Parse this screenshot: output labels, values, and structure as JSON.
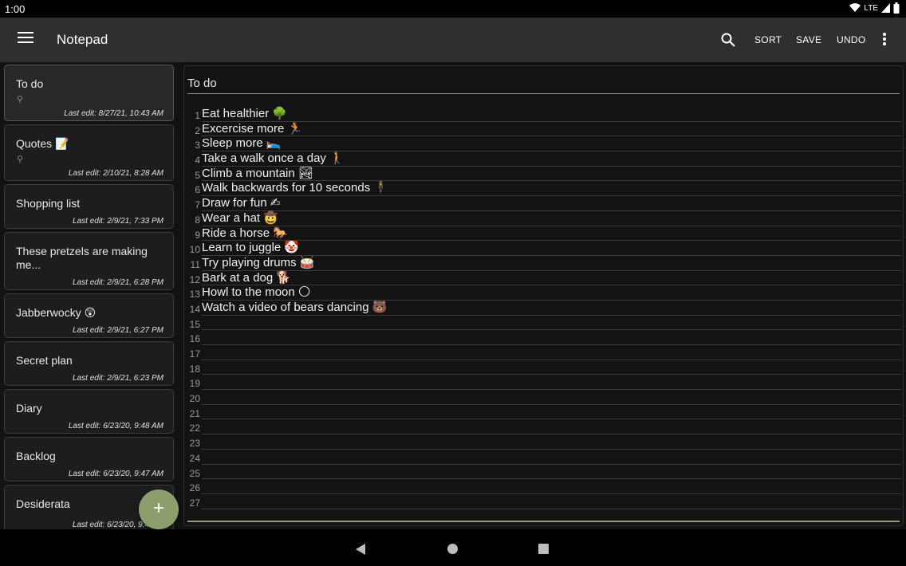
{
  "status_bar": {
    "time": "1:00",
    "network": "LTE"
  },
  "app_bar": {
    "title": "Notepad",
    "actions": {
      "sort": "SORT",
      "save": "SAVE",
      "undo": "UNDO"
    }
  },
  "notes": [
    {
      "title": "To do",
      "date": "Last edit: 8/27/21, 10:43 AM",
      "pinned": true,
      "selected": true
    },
    {
      "title": "Quotes 📝",
      "date": "Last edit: 2/10/21, 8:28 AM",
      "pinned": true
    },
    {
      "title": "Shopping list",
      "date": "Last edit: 2/9/21, 7:33 PM"
    },
    {
      "title": "These pretzels are making me...",
      "date": "Last edit: 2/9/21, 6:28 PM"
    },
    {
      "title": "Jabberwocky 😲",
      "date": "Last edit: 2/9/21, 6:27 PM"
    },
    {
      "title": "Secret plan",
      "date": "Last edit: 2/9/21, 6:23 PM"
    },
    {
      "title": "Diary",
      "date": "Last edit: 6/23/20, 9:48 AM"
    },
    {
      "title": "Backlog",
      "date": "Last edit: 6/23/20, 9:47 AM"
    },
    {
      "title": "Desiderata",
      "date": "Last edit: 6/23/20, 9:4"
    }
  ],
  "fab": {
    "label": "+"
  },
  "editor": {
    "title": "To do",
    "lines": [
      {
        "n": "1",
        "text": "Eat healthier 🌳"
      },
      {
        "n": "2",
        "text": "Excercise more 🏃"
      },
      {
        "n": "3",
        "text": "Sleep more 🛌"
      },
      {
        "n": "4",
        "text": "Take a walk once a day 🚶"
      },
      {
        "n": "5",
        "text": "Climb a mountain 🏞"
      },
      {
        "n": "6",
        "text": "Walk backwards for 10 seconds 🕴"
      },
      {
        "n": "7",
        "text": "Draw for fun ✍"
      },
      {
        "n": "8",
        "text": "Wear a hat 🤠"
      },
      {
        "n": "9",
        "text": "Ride a horse 🐎"
      },
      {
        "n": "10",
        "text": "Learn to juggle 🤡"
      },
      {
        "n": "11",
        "text": "Try playing drums 🥁"
      },
      {
        "n": "12",
        "text": "Bark at a dog 🐕"
      },
      {
        "n": "13",
        "text": "Howl to the moon 🌕"
      },
      {
        "n": "14",
        "text": "Watch a video of bears dancing 🐻"
      },
      {
        "n": "15",
        "text": ""
      },
      {
        "n": "16",
        "text": ""
      },
      {
        "n": "17",
        "text": ""
      },
      {
        "n": "18",
        "text": ""
      },
      {
        "n": "19",
        "text": ""
      },
      {
        "n": "20",
        "text": ""
      },
      {
        "n": "21",
        "text": ""
      },
      {
        "n": "22",
        "text": ""
      },
      {
        "n": "23",
        "text": ""
      },
      {
        "n": "24",
        "text": ""
      },
      {
        "n": "25",
        "text": ""
      },
      {
        "n": "26",
        "text": ""
      },
      {
        "n": "27",
        "text": ""
      }
    ]
  },
  "colors": {
    "accent": "#8c9e6c",
    "app_bar": "#2f2f2f",
    "background": "#111111"
  },
  "icons": [
    "menu-icon",
    "search-icon",
    "more-vert-icon",
    "pin-icon",
    "add-icon",
    "back-icon",
    "home-icon",
    "recents-icon",
    "wifi-icon",
    "signal-icon",
    "battery-icon"
  ]
}
